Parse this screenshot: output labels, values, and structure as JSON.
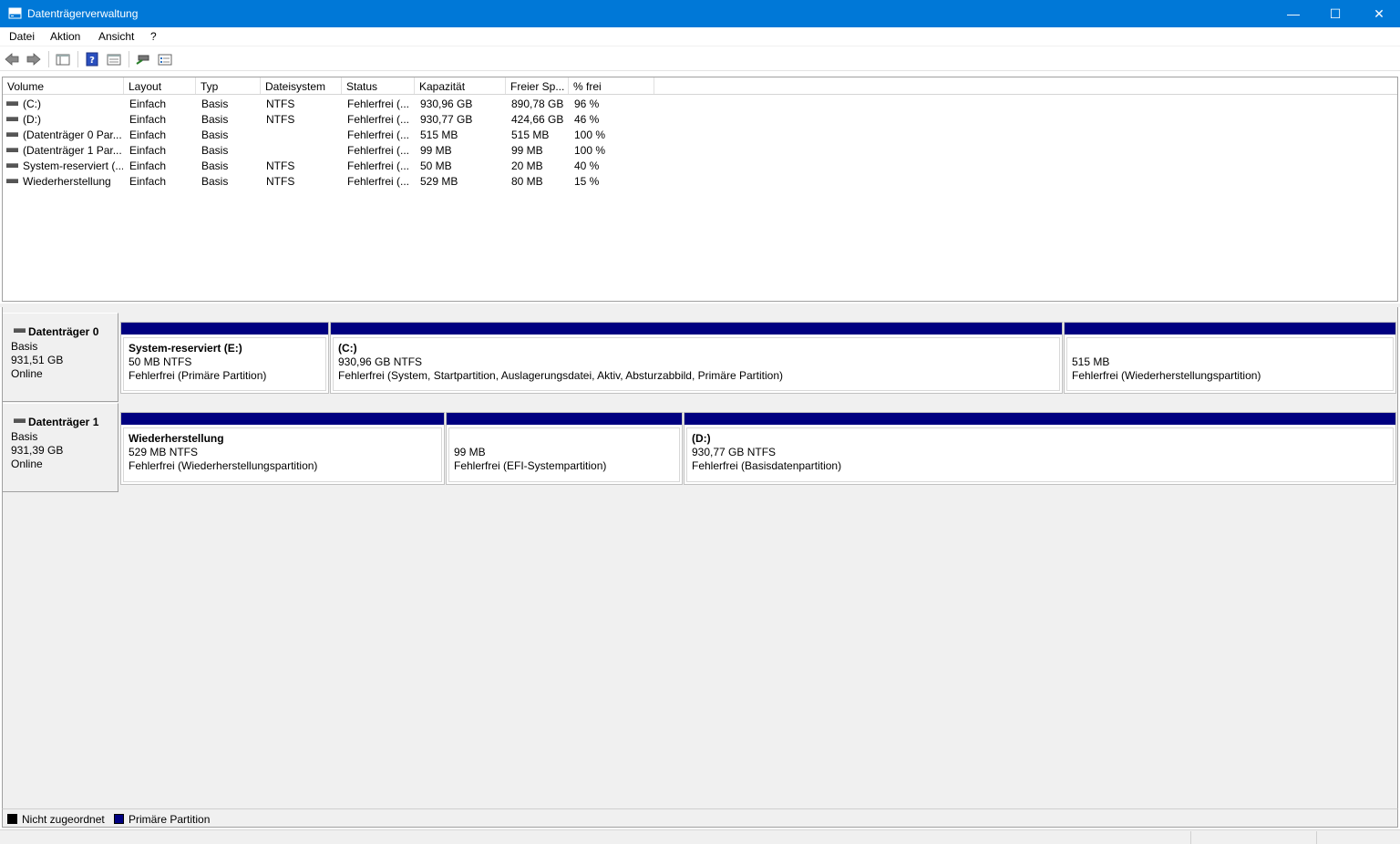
{
  "window": {
    "title": "Datenträgerverwaltung",
    "minimize_glyph": "—",
    "maximize_glyph": "☐",
    "close_glyph": "✕"
  },
  "menu": [
    "Datei",
    "Aktion",
    "Ansicht",
    "?"
  ],
  "toolbar": {
    "icons": [
      "back-arrow-icon",
      "forward-arrow-icon",
      "console-tree-icon",
      "help-icon",
      "properties-icon",
      "rescan-icon",
      "settings-list-icon"
    ]
  },
  "volume_list": {
    "columns": [
      "Volume",
      "Layout",
      "Typ",
      "Dateisystem",
      "Status",
      "Kapazität",
      "Freier Sp...",
      "% frei"
    ],
    "rows": [
      {
        "volume": "(C:)",
        "layout": "Einfach",
        "typ": "Basis",
        "fs": "NTFS",
        "status": "Fehlerfrei (...",
        "kapazitaet": "930,96 GB",
        "frei": "890,78 GB",
        "prozent": "96 %"
      },
      {
        "volume": "(D:)",
        "layout": "Einfach",
        "typ": "Basis",
        "fs": "NTFS",
        "status": "Fehlerfrei (...",
        "kapazitaet": "930,77 GB",
        "frei": "424,66 GB",
        "prozent": "46 %"
      },
      {
        "volume": "(Datenträger 0 Par...",
        "layout": "Einfach",
        "typ": "Basis",
        "fs": "",
        "status": "Fehlerfrei (...",
        "kapazitaet": "515 MB",
        "frei": "515 MB",
        "prozent": "100 %"
      },
      {
        "volume": "(Datenträger 1 Par...",
        "layout": "Einfach",
        "typ": "Basis",
        "fs": "",
        "status": "Fehlerfrei (...",
        "kapazitaet": "99 MB",
        "frei": "99 MB",
        "prozent": "100 %"
      },
      {
        "volume": "System-reserviert (...",
        "layout": "Einfach",
        "typ": "Basis",
        "fs": "NTFS",
        "status": "Fehlerfrei (...",
        "kapazitaet": "50 MB",
        "frei": "20 MB",
        "prozent": "40 %"
      },
      {
        "volume": "Wiederherstellung",
        "layout": "Einfach",
        "typ": "Basis",
        "fs": "NTFS",
        "status": "Fehlerfrei (...",
        "kapazitaet": "529 MB",
        "frei": "80 MB",
        "prozent": "15 %"
      }
    ]
  },
  "disks": [
    {
      "name": "Datenträger 0",
      "type": "Basis",
      "size": "931,51 GB",
      "state": "Online",
      "partitions": [
        {
          "title": "System-reserviert  (E:)",
          "size": "50 MB NTFS",
          "status": "Fehlerfrei (Primäre Partition)"
        },
        {
          "title": "(C:)",
          "size": "930,96 GB NTFS",
          "status": "Fehlerfrei (System, Startpartition, Auslagerungsdatei, Aktiv, Absturzabbild, Primäre Partition)"
        },
        {
          "title": "",
          "size": "515 MB",
          "status": "Fehlerfrei (Wiederherstellungspartition)"
        }
      ]
    },
    {
      "name": "Datenträger 1",
      "type": "Basis",
      "size": "931,39 GB",
      "state": "Online",
      "partitions": [
        {
          "title": "Wiederherstellung",
          "size": "529 MB NTFS",
          "status": "Fehlerfrei (Wiederherstellungspartition)"
        },
        {
          "title": "",
          "size": "99 MB",
          "status": "Fehlerfrei (EFI-Systempartition)"
        },
        {
          "title": "(D:)",
          "size": "930,77 GB NTFS",
          "status": "Fehlerfrei (Basisdatenpartition)"
        }
      ]
    }
  ],
  "legend": [
    {
      "label": "Nicht zugeordnet",
      "color": "#000000"
    },
    {
      "label": "Primäre Partition",
      "color": "#000080"
    }
  ]
}
